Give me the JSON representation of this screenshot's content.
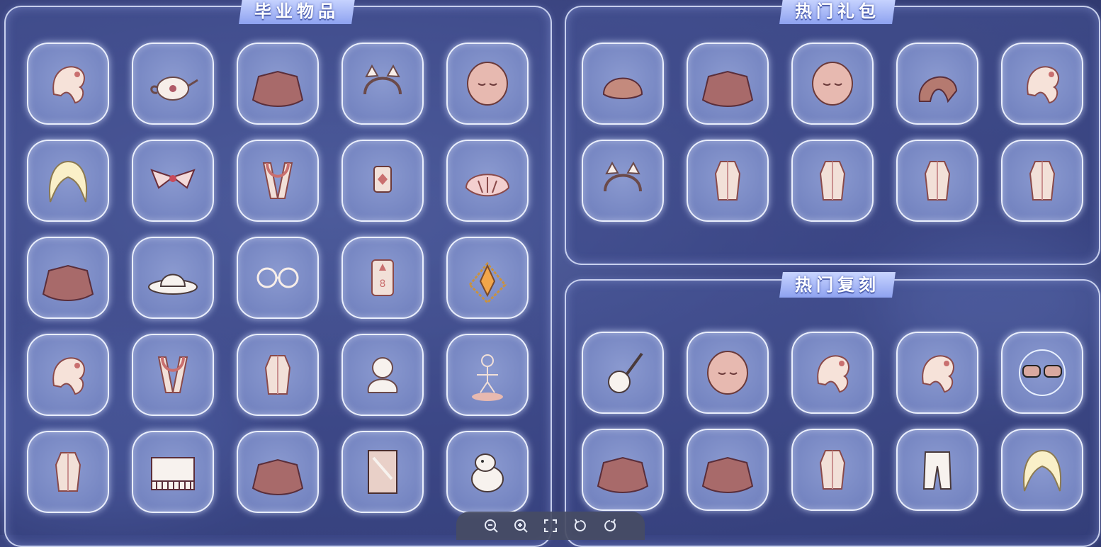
{
  "panels": {
    "graduation": {
      "title": "毕业物品",
      "items": [
        "hair-icon",
        "teapot-icon",
        "cape-icon",
        "headband-icon",
        "mask-icon",
        "long-hair-icon",
        "wing-ornament-icon",
        "scarf-icon",
        "instrument-icon",
        "shell-icon",
        "cape-icon",
        "cowboy-hat-icon",
        "glasses-icon",
        "lantern-icon",
        "sash-icon",
        "hair-icon",
        "scarf-icon",
        "outfit-icon",
        "hair-bun-icon",
        "statue-icon",
        "outfit-icon",
        "piano-icon",
        "cape-icon",
        "card-icon",
        "moomin-icon"
      ]
    },
    "gift_packs": {
      "title": "热门礼包",
      "items": [
        "hat-icon",
        "cape-icon",
        "mask-icon",
        "hood-icon",
        "hair-icon",
        "headband-icon",
        "outfit-icon",
        "outfit-icon",
        "outfit-icon",
        "outfit-icon"
      ]
    },
    "reruns": {
      "title": "热门复刻",
      "items": [
        "guitar-icon",
        "mask-icon",
        "hair-icon",
        "hair-icon",
        "sunglasses-icon",
        "cape-icon",
        "cape-icon",
        "outfit-icon",
        "pants-icon",
        "long-hair-icon"
      ]
    }
  },
  "toolbar": [
    "zoom-out-icon",
    "zoom-in-icon",
    "fullscreen-icon",
    "rotate-left-icon",
    "rotate-right-icon"
  ]
}
